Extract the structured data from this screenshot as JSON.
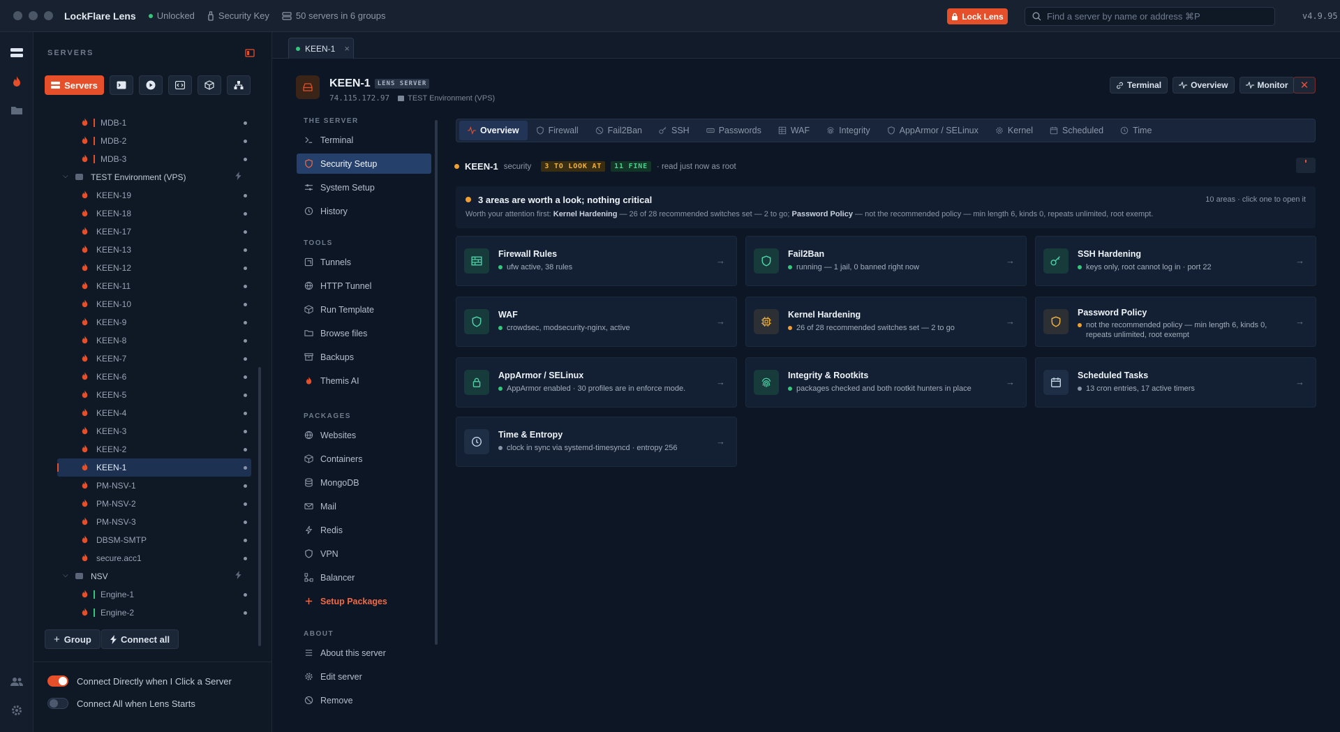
{
  "titlebar": {
    "app_name": "LockFlare Lens",
    "lock_status": "Unlocked",
    "key_label": "Security Key",
    "servers_summary": "50 servers in 6 groups",
    "lock_button": "Lock Lens",
    "search_placeholder": "Find a server by name or address ⌘P",
    "version": "v4.9.95"
  },
  "sidebar": {
    "title": "SERVERS",
    "servers_tab": "Servers",
    "tree": [
      {
        "type": "server",
        "name": "MDB-1",
        "flame": true,
        "color_bar": "#e5502a",
        "indent": true
      },
      {
        "type": "server",
        "name": "MDB-2",
        "flame": true,
        "color_bar": "#e5502a",
        "indent": true
      },
      {
        "type": "server",
        "name": "MDB-3",
        "flame": true,
        "color_bar": "#e5502a",
        "indent": true
      },
      {
        "type": "group",
        "name": "TEST Environment (VPS)"
      },
      {
        "type": "server",
        "name": "KEEN-19",
        "flame": true
      },
      {
        "type": "server",
        "name": "KEEN-18",
        "flame": true
      },
      {
        "type": "server",
        "name": "KEEN-17",
        "flame": true
      },
      {
        "type": "server",
        "name": "KEEN-13",
        "flame": true
      },
      {
        "type": "server",
        "name": "KEEN-12",
        "flame": true
      },
      {
        "type": "server",
        "name": "KEEN-11",
        "flame": true
      },
      {
        "type": "server",
        "name": "KEEN-10",
        "flame": true
      },
      {
        "type": "server",
        "name": "KEEN-9",
        "flame": true
      },
      {
        "type": "server",
        "name": "KEEN-8",
        "flame": true
      },
      {
        "type": "server",
        "name": "KEEN-7",
        "flame": true
      },
      {
        "type": "server",
        "name": "KEEN-6",
        "flame": true
      },
      {
        "type": "server",
        "name": "KEEN-5",
        "flame": true
      },
      {
        "type": "server",
        "name": "KEEN-4",
        "flame": true
      },
      {
        "type": "server",
        "name": "KEEN-3",
        "flame": true
      },
      {
        "type": "server",
        "name": "KEEN-2",
        "flame": true
      },
      {
        "type": "server",
        "name": "KEEN-1",
        "flame": true,
        "selected": true
      },
      {
        "type": "server",
        "name": "PM-NSV-1",
        "flame": true
      },
      {
        "type": "server",
        "name": "PM-NSV-2",
        "flame": true
      },
      {
        "type": "server",
        "name": "PM-NSV-3",
        "flame": true
      },
      {
        "type": "server",
        "name": "DBSM-SMTP",
        "flame": true
      },
      {
        "type": "server",
        "name": "secure.acc1",
        "flame": true
      },
      {
        "type": "group",
        "name": "NSV"
      },
      {
        "type": "server",
        "name": "Engine-1",
        "flame": true,
        "color_bar": "#34c77b",
        "indent": true
      },
      {
        "type": "server",
        "name": "Engine-2",
        "flame": true,
        "color_bar": "#34c77b",
        "indent": true
      }
    ],
    "group_button": "Group",
    "connect_all_button": "Connect all",
    "toggle_connect_direct": "Connect Directly when I Click a Server",
    "toggle_connect_direct_on": true,
    "toggle_connect_all": "Connect All when Lens Starts",
    "toggle_connect_all_on": false
  },
  "tabstrip": {
    "open_tab": "KEEN-1"
  },
  "server": {
    "name": "KEEN-1",
    "tag": "LENS SERVER",
    "ip": "74.115.172.97",
    "group": "TEST Environment (VPS)",
    "actions": [
      "Terminal",
      "Overview",
      "Monitor"
    ]
  },
  "subnav": {
    "sections": [
      {
        "title": "THE SERVER",
        "items": [
          {
            "label": "Terminal",
            "icon": "terminal-icon"
          },
          {
            "label": "Security Setup",
            "icon": "shield-icon",
            "active": true
          },
          {
            "label": "System Setup",
            "icon": "sliders-icon"
          },
          {
            "label": "History",
            "icon": "history-icon"
          }
        ]
      },
      {
        "title": "TOOLS",
        "items": [
          {
            "label": "Tunnels",
            "icon": "tunnel-icon"
          },
          {
            "label": "HTTP Tunnel",
            "icon": "globe-icon"
          },
          {
            "label": "Run Template",
            "icon": "box-icon"
          },
          {
            "label": "Browse files",
            "icon": "folder-icon"
          },
          {
            "label": "Backups",
            "icon": "archive-icon"
          },
          {
            "label": "Themis AI",
            "icon": "flame-icon"
          }
        ]
      },
      {
        "title": "PACKAGES",
        "items": [
          {
            "label": "Websites",
            "icon": "globe-icon"
          },
          {
            "label": "Containers",
            "icon": "box-icon"
          },
          {
            "label": "MongoDB",
            "icon": "database-icon"
          },
          {
            "label": "Mail",
            "icon": "mail-icon"
          },
          {
            "label": "Redis",
            "icon": "bolt-icon"
          },
          {
            "label": "VPN",
            "icon": "shield-icon"
          },
          {
            "label": "Balancer",
            "icon": "balancer-icon"
          },
          {
            "label": "Setup Packages",
            "icon": "plus-icon",
            "accent": true
          }
        ]
      },
      {
        "title": "ABOUT",
        "items": [
          {
            "label": "About this server",
            "icon": "list-icon"
          },
          {
            "label": "Edit server",
            "icon": "gear-icon"
          },
          {
            "label": "Remove",
            "icon": "ban-icon"
          }
        ]
      }
    ]
  },
  "content_tabs": [
    {
      "label": "Overview",
      "icon": "activity-icon",
      "active": true
    },
    {
      "label": "Firewall",
      "icon": "shield-icon"
    },
    {
      "label": "Fail2Ban",
      "icon": "ban-icon"
    },
    {
      "label": "SSH",
      "icon": "key-icon"
    },
    {
      "label": "Passwords",
      "icon": "password-icon"
    },
    {
      "label": "WAF",
      "icon": "grid-icon"
    },
    {
      "label": "Integrity",
      "icon": "fingerprint-icon"
    },
    {
      "label": "AppArmor / SELinux",
      "icon": "shield-icon"
    },
    {
      "label": "Kernel",
      "icon": "gear-icon"
    },
    {
      "label": "Scheduled",
      "icon": "calendar-icon"
    },
    {
      "label": "Time",
      "icon": "clock-icon"
    }
  ],
  "status": {
    "server": "KEEN-1",
    "label": "security",
    "look_chip": "3 TO LOOK AT",
    "fine_chip": "11 FINE",
    "read_note": "· read just now as root"
  },
  "summary": {
    "headline": "3 areas are worth a look; nothing critical",
    "hint": "10 areas · click one to open it",
    "lead": "Worth your attention first:",
    "item1_name": "Kernel Hardening",
    "item1_text": "— 26 of 28 recommended switches set — 2 to go;",
    "item2_name": "Password Policy",
    "item2_text": "— not the recommended policy — min length 6, kinds 0, repeats unlimited, root exempt."
  },
  "cards": [
    {
      "title": "Firewall Rules",
      "sub": "ufw active, 38 rules",
      "status": "ok",
      "icon": "firewall-icon"
    },
    {
      "title": "Fail2Ban",
      "sub": "running — 1 jail, 0 banned right now",
      "status": "ok",
      "icon": "shield-icon"
    },
    {
      "title": "SSH Hardening",
      "sub": "keys only, root cannot log in · port 22",
      "status": "ok",
      "icon": "key-icon"
    },
    {
      "title": "WAF",
      "sub": "crowdsec, modsecurity-nginx, active",
      "status": "ok",
      "icon": "shield-icon"
    },
    {
      "title": "Kernel Hardening",
      "sub": "26 of 28 recommended switches set — 2 to go",
      "status": "warn",
      "icon": "chip-icon"
    },
    {
      "title": "Password Policy",
      "sub": "not the recommended policy — min length 6, kinds 0, repeats unlimited, root exempt",
      "status": "warn",
      "icon": "shield-icon"
    },
    {
      "title": "AppArmor / SELinux",
      "sub": "AppArmor enabled · 30 profiles are in enforce mode.",
      "status": "ok",
      "icon": "lock-icon"
    },
    {
      "title": "Integrity & Rootkits",
      "sub": "packages checked and both rootkit hunters in place",
      "status": "ok",
      "icon": "fingerprint-icon"
    },
    {
      "title": "Scheduled Tasks",
      "sub": "13 cron entries, 17 active timers",
      "status": "neutral",
      "icon": "calendar-icon"
    },
    {
      "title": "Time & Entropy",
      "sub": "clock in sync via systemd-timesyncd · entropy 256",
      "status": "neutral",
      "icon": "clock-icon"
    }
  ],
  "colors": {
    "accent": "#e5502a",
    "ok": "#34c77b",
    "warn": "#f0a030",
    "neutral": "#8a96a8",
    "selected": "#25406a"
  }
}
